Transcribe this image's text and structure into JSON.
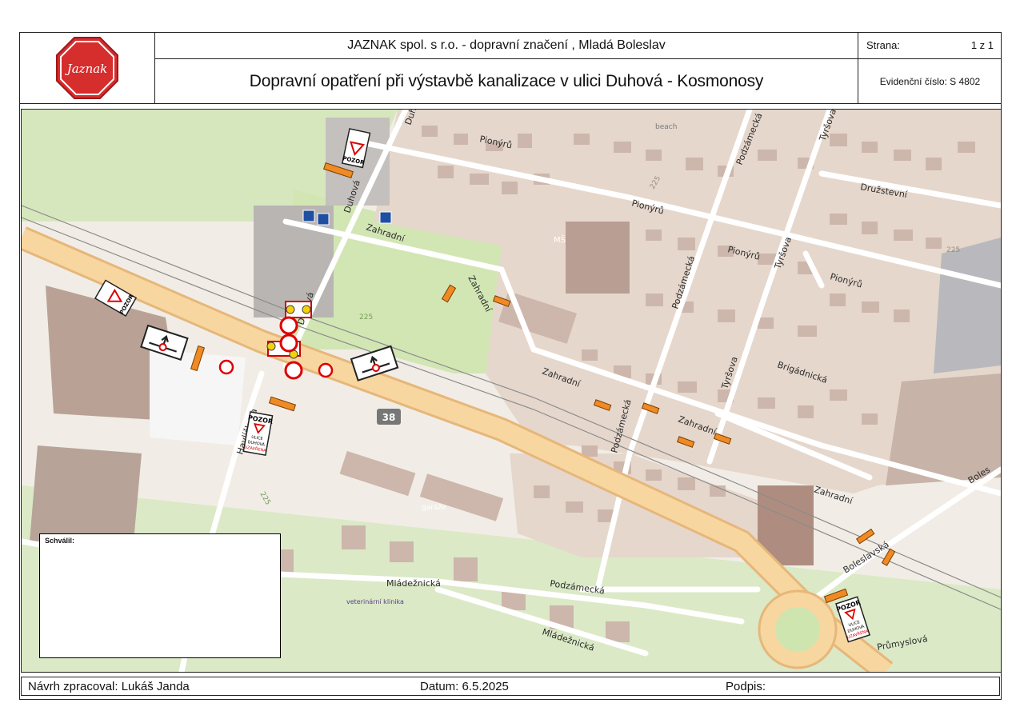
{
  "header": {
    "company": "JAZNAK spol. s r.o. - dopravní značení , Mladá Boleslav",
    "title": "Dopravní opatření při výstavbě kanalizace v ulici Duhová - Kosmonosy",
    "page_label": "Strana:",
    "page_value": "1  z  1",
    "evidence": "Evidenční číslo: S 4802",
    "logo_text": "Jaznak"
  },
  "map": {
    "streets": {
      "pionyru_1": "Pionýrů",
      "pionyru_2": "Pionýrů",
      "pionyru_3": "Pionýrů",
      "pionyru_4": "Pionýrů",
      "druzstevni": "Družstevní",
      "zahradni_1": "Zahradní",
      "zahradni_2": "Zahradní",
      "zahradni_3": "Zahradní",
      "zahradni_4": "Zahradní",
      "zahradni_5": "Zahradní",
      "duhova_1": "Duhová",
      "duhova_2": "Duhová",
      "podzamecka_1": "Podzámecká",
      "podzamecka_2": "Podzámecká",
      "podzamecka_3": "Podzámecká",
      "podzamecka_4": "Podzámecká",
      "tyrsova_1": "Tyršova",
      "tyrsova_2": "Tyršova",
      "tyrsova_3": "Tyršova",
      "brigadnicka": "Brigádnická",
      "havlickova": "Havlíčkova",
      "mladeznicka_1": "Mládežnická",
      "mladeznicka_2": "Mládežnická",
      "boleslavska": "Boleslavská",
      "bolesl": "Boles",
      "prumyslova": "Průmyslová"
    },
    "pois": {
      "beach": "beach",
      "ms": "MŠ",
      "garaze": "garáže",
      "vet": "veterinární klinika",
      "road_number": "38",
      "elev_1": "225",
      "elev_2": "225",
      "elev_3": "225",
      "elev_4": "225"
    },
    "sign_texts": {
      "pozor": "POZOR",
      "ulice": "ULICE",
      "duhova": "DUHOVÁ",
      "uzavrena": "UZAVŘENA"
    },
    "colors": {
      "main_road": "#f8d6a0",
      "main_road_edge": "#e6b77a",
      "built_area": "#e6d6cc",
      "building": "#c9b2a8",
      "park": "#cfe5b0",
      "residential_street": "#ffffff",
      "detour_arrow": "#f08a24"
    }
  },
  "approval": {
    "label": "Schválil:"
  },
  "footer": {
    "author": "Návrh zpracoval: Lukáš Janda",
    "date": "Datum: 6.5.2025",
    "signature": "Podpis:"
  }
}
